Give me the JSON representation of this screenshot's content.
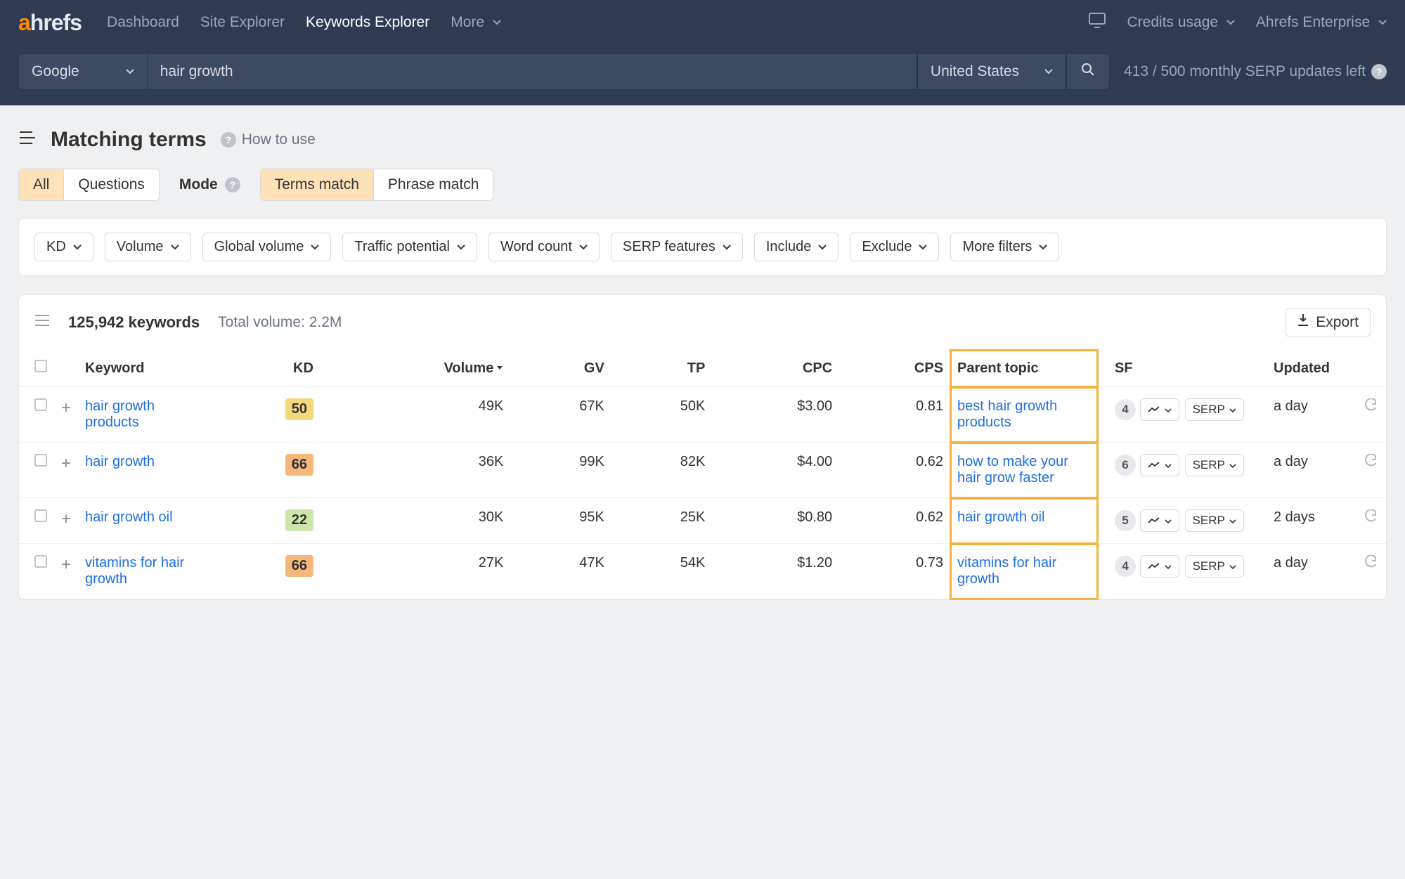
{
  "nav": {
    "logo_a": "a",
    "logo_rest": "hrefs",
    "dashboard": "Dashboard",
    "site_explorer": "Site Explorer",
    "keywords_explorer": "Keywords Explorer",
    "more": "More",
    "credits": "Credits usage",
    "enterprise": "Ahrefs Enterprise"
  },
  "search": {
    "engine": "Google",
    "query": "hair growth",
    "country": "United States",
    "credits_left": "413 / 500 monthly SERP updates left"
  },
  "page": {
    "title": "Matching terms",
    "how_to_use": "How to use",
    "tabs": {
      "all": "All",
      "questions": "Questions"
    },
    "mode_label": "Mode",
    "mode_tabs": {
      "terms": "Terms match",
      "phrase": "Phrase match"
    }
  },
  "filters": {
    "kd": "KD",
    "volume": "Volume",
    "global_volume": "Global volume",
    "traffic_potential": "Traffic potential",
    "word_count": "Word count",
    "serp_features": "SERP features",
    "include": "Include",
    "exclude": "Exclude",
    "more_filters": "More filters"
  },
  "summary": {
    "count": "125,942 keywords",
    "total_volume": "Total volume: 2.2M",
    "export": "Export"
  },
  "columns": {
    "keyword": "Keyword",
    "kd": "KD",
    "volume": "Volume",
    "gv": "GV",
    "tp": "TP",
    "cpc": "CPC",
    "cps": "CPS",
    "parent_topic": "Parent topic",
    "sf": "SF",
    "updated": "Updated"
  },
  "buttons": {
    "serp": "SERP"
  },
  "rows": [
    {
      "keyword": "hair growth products",
      "kd": 50,
      "kd_color": "#f5d879",
      "volume": "49K",
      "gv": "67K",
      "tp": "50K",
      "cpc": "$3.00",
      "cps": "0.81",
      "parent": "best hair growth products",
      "sf": 4,
      "updated": "a day"
    },
    {
      "keyword": "hair growth",
      "kd": 66,
      "kd_color": "#f5b87a",
      "volume": "36K",
      "gv": "99K",
      "tp": "82K",
      "cpc": "$4.00",
      "cps": "0.62",
      "parent": "how to make your hair grow faster",
      "sf": 6,
      "updated": "a day"
    },
    {
      "keyword": "hair growth oil",
      "kd": 22,
      "kd_color": "#cbe6a8",
      "volume": "30K",
      "gv": "95K",
      "tp": "25K",
      "cpc": "$0.80",
      "cps": "0.62",
      "parent": "hair growth oil",
      "sf": 5,
      "updated": "2 days"
    },
    {
      "keyword": "vitamins for hair growth",
      "kd": 66,
      "kd_color": "#f5b87a",
      "volume": "27K",
      "gv": "47K",
      "tp": "54K",
      "cpc": "$1.20",
      "cps": "0.73",
      "parent": "vitamins for hair growth",
      "sf": 4,
      "updated": "a day"
    }
  ]
}
